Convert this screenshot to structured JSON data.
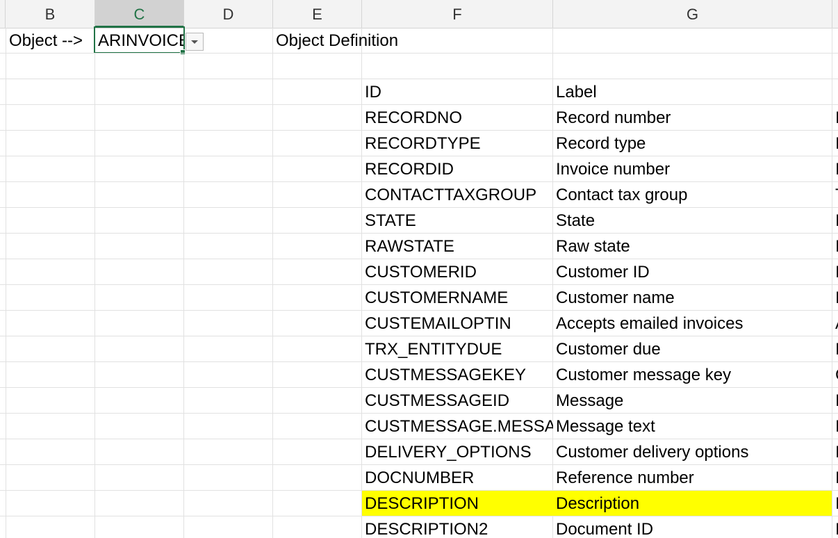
{
  "columns": [
    "B",
    "C",
    "D",
    "E",
    "F",
    "G"
  ],
  "active_column": "C",
  "row1": {
    "b": "Object -->",
    "c": "ARINVOICE",
    "e": "Object Definition"
  },
  "table": {
    "header": {
      "id": "ID",
      "label": "Label"
    },
    "rows": [
      {
        "id": "RECORDNO",
        "label": "Record number",
        "g": "I"
      },
      {
        "id": "RECORDTYPE",
        "label": "Record type",
        "g": "I"
      },
      {
        "id": "RECORDID",
        "label": "Invoice number",
        "g": "I"
      },
      {
        "id": "CONTACTTAXGROUP",
        "label": "Contact tax group",
        "g": "T"
      },
      {
        "id": "STATE",
        "label": "State",
        "g": "I"
      },
      {
        "id": "RAWSTATE",
        "label": "Raw state",
        "g": "I"
      },
      {
        "id": "CUSTOMERID",
        "label": "Customer ID",
        "g": "I"
      },
      {
        "id": "CUSTOMERNAME",
        "label": "Customer name",
        "g": "I"
      },
      {
        "id": "CUSTEMAILOPTIN",
        "label": "Accepts emailed invoices",
        "g": "A"
      },
      {
        "id": "TRX_ENTITYDUE",
        "label": "Customer due",
        "g": "I"
      },
      {
        "id": "CUSTMESSAGEKEY",
        "label": "Customer message key",
        "g": "C"
      },
      {
        "id": "CUSTMESSAGEID",
        "label": "Message",
        "g": "I"
      },
      {
        "id": "CUSTMESSAGE.MESSAG",
        "label": "Message text",
        "g": "I"
      },
      {
        "id": "DELIVERY_OPTIONS",
        "label": "Customer delivery options",
        "g": "I"
      },
      {
        "id": "DOCNUMBER",
        "label": "Reference number",
        "g": "I"
      },
      {
        "id": "DESCRIPTION",
        "label": "Description",
        "g": "I",
        "highlight": true
      },
      {
        "id": "DESCRIPTION2",
        "label": "Document ID",
        "g": "I"
      }
    ]
  },
  "colors": {
    "highlight": "#ffff00",
    "accent": "#217346"
  },
  "icons": {
    "dropdown": "chevron-down-icon"
  }
}
